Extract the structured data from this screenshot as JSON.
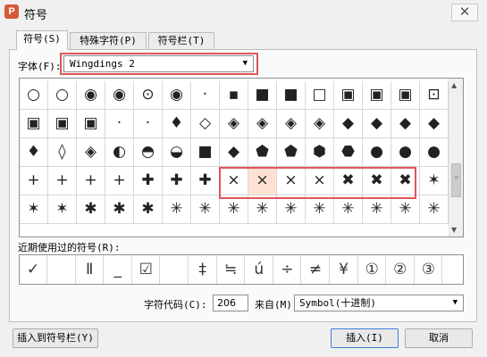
{
  "window": {
    "title": "符号",
    "app_icon": "P",
    "close_glyph": "✕"
  },
  "tabs": [
    {
      "label": "符号(S)",
      "active": true
    },
    {
      "label": "特殊字符(P)",
      "active": false
    },
    {
      "label": "符号栏(T)",
      "active": false
    }
  ],
  "font": {
    "label": "字体(F):",
    "value": "Wingdings 2",
    "arrow": "▼"
  },
  "symbol_grid": {
    "rows": [
      [
        "○",
        "○",
        "◉",
        "◉",
        "⊙",
        "◉",
        "·",
        "▪",
        "■",
        "■",
        "□",
        "▣",
        "▣",
        "▣",
        "⊡"
      ],
      [
        "▣",
        "▣",
        "▣",
        "·",
        "·",
        "♦",
        "◇",
        "◈",
        "◈",
        "◈",
        "◈",
        "◆",
        "◆",
        "◆",
        "◆"
      ],
      [
        "♦",
        "◊",
        "◈",
        "◐",
        "◓",
        "◒",
        "■",
        "◆",
        "⬟",
        "⬟",
        "⬢",
        "⬣",
        "●",
        "●",
        "●"
      ],
      [
        "+",
        "+",
        "+",
        "+",
        "✚",
        "✚",
        "✚",
        "×",
        "×",
        "×",
        "×",
        "✖",
        "✖",
        "✖",
        "✶"
      ],
      [
        "✶",
        "✶",
        "✱",
        "✱",
        "✱",
        "✳",
        "✳",
        "✳",
        "✳",
        "✳",
        "✳",
        "✳",
        "✳",
        "✳",
        "✳"
      ]
    ],
    "selected": {
      "row": 3,
      "col": 8
    }
  },
  "scrollbar": {
    "up": "▲",
    "down": "▼",
    "grip": "≡"
  },
  "recent": {
    "label": "近期使用过的符号(R):",
    "items": [
      "✓",
      "",
      "Ⅱ",
      "_",
      "☑",
      "",
      "‡",
      "≒",
      "ú",
      "÷",
      "≠",
      "¥",
      "①",
      "②",
      "③"
    ]
  },
  "char_code": {
    "label": "字符代码(C):",
    "value": "206"
  },
  "from": {
    "label": "来自(M)",
    "value": "Symbol(十进制)",
    "arrow": "▼"
  },
  "buttons": {
    "insert_to_bar": "插入到符号栏(Y)",
    "insert": "插入(I)",
    "cancel": "取消"
  }
}
